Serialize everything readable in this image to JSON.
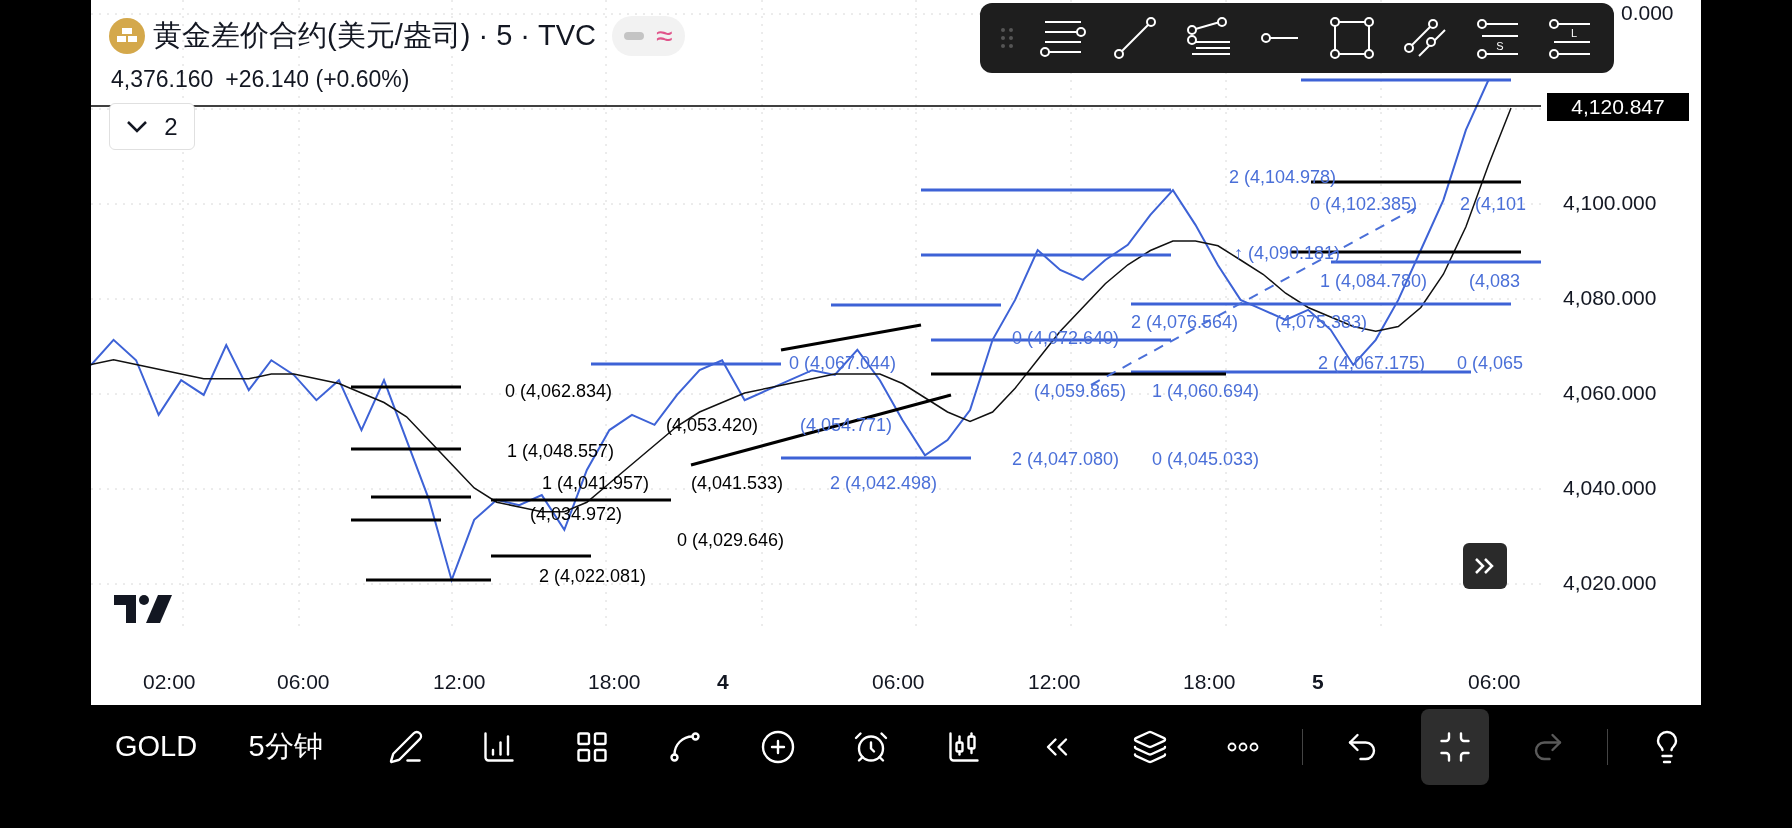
{
  "header": {
    "title": "黄金差价合约(美元/盎司) · 5 · TVC",
    "wave_glyph": "≈",
    "price": "4,376.160",
    "change": "+26.140 (+0.60%)"
  },
  "indicator_toggle": {
    "count": "2"
  },
  "drawing_toolbar": {
    "tools": [
      {
        "kind": "lines"
      },
      {
        "kind": "segment"
      },
      {
        "kind": "fib"
      },
      {
        "kind": "ray"
      },
      {
        "kind": "rect"
      },
      {
        "kind": "parallel"
      },
      {
        "kind": "short",
        "glyph": "S"
      },
      {
        "kind": "long",
        "glyph": "L"
      }
    ]
  },
  "price_axis": {
    "current_price": "4,120.847",
    "cut_label": "0.000"
  },
  "chart": {
    "chart_data": {
      "type": "line",
      "ylim": [
        4020,
        4140
      ],
      "grid": true,
      "yticks": [
        {
          "value": 4100,
          "label": "4,100.000"
        },
        {
          "value": 4080,
          "label": "4,080.000"
        },
        {
          "value": 4060,
          "label": "4,060.000"
        },
        {
          "value": 4040,
          "label": "4,040.000"
        },
        {
          "value": 4020,
          "label": "4,020.000"
        }
      ],
      "series": [
        {
          "color": "#3d62d6",
          "values": [
            4065.9,
            4071.2,
            4066.9,
            4055.4,
            4062.7,
            4059.6,
            4070.1,
            4060.6,
            4066.9,
            4063.8,
            4058.5,
            4062.7,
            4052.2,
            4062.7,
            4050.1,
            4037.5,
            4020.6,
            4033.3,
            4037.5,
            4036.4,
            4038.5,
            4031.2,
            4043.8,
            4052.2,
            4055.4,
            4053.3,
            4059.6,
            4064.8,
            4066.9,
            4058.5,
            4060.6,
            4062.7,
            4064.8,
            4063.8,
            4069.1,
            4062.7,
            4054.3,
            4046.9,
            4050.1,
            4056.4,
            4071.2,
            4079.6,
            4090.1,
            4085.9,
            4083.8,
            4088,
            4091.2,
            4097.5,
            4102.7,
            4095.4,
            4086.9,
            4079.6,
            4077.5,
            4075.4,
            4077.5,
            4073.3,
            4065.9,
            4071.2,
            4079.6,
            4090.1,
            4100.6,
            4115.4,
            4125.9,
            null
          ]
        },
        {
          "color": "#111111",
          "values": [
            4066,
            4067,
            4066,
            4065,
            4064,
            4063,
            4063,
            4063,
            4064,
            4064,
            4063,
            4062,
            4060,
            4058,
            4055,
            4050,
            4045,
            4040,
            4037,
            4036,
            4035,
            4035,
            4037,
            4041,
            4045,
            4049,
            4053,
            4056,
            4058,
            4060,
            4061,
            4062,
            4063,
            4064,
            4064,
            4064,
            4062,
            4059,
            4056,
            4054,
            4056,
            4061,
            4067,
            4073,
            4078,
            4083,
            4087,
            4090,
            4092,
            4092,
            4091,
            4088,
            4085,
            4081,
            4078,
            4076,
            4074,
            4073,
            4074,
            4078,
            4085,
            4095,
            4108,
            4120
          ]
        }
      ]
    }
  },
  "time_axis": {
    "labels": [
      {
        "text": "02:00",
        "bold": false
      },
      {
        "text": "06:00",
        "bold": false
      },
      {
        "text": "12:00",
        "bold": false
      },
      {
        "text": "18:00",
        "bold": false
      },
      {
        "text": "4",
        "bold": true
      },
      {
        "text": "06:00",
        "bold": false
      },
      {
        "text": "12:00",
        "bold": false
      },
      {
        "text": "18:00",
        "bold": false
      },
      {
        "text": "5",
        "bold": true
      },
      {
        "text": "06:00",
        "bold": false
      }
    ]
  },
  "drawing_labels": [
    {
      "text": "2 (4,104.978)",
      "color": "#4a6fd8"
    },
    {
      "text": "0 (4,102.385)",
      "color": "#4a6fd8"
    },
    {
      "text": "2 (4,101",
      "color": "#4a6fd8"
    },
    {
      "text": "↑ (4,090.181)",
      "color": "#4a6fd8"
    },
    {
      "text": "1 (4,084.780)",
      "color": "#4a6fd8"
    },
    {
      "text": "(4,083",
      "color": "#4a6fd8"
    },
    {
      "text": "2 (4,076.564)",
      "color": "#4a6fd8"
    },
    {
      "text": "(4,075.383)",
      "color": "#4a6fd8"
    },
    {
      "text": "0 (4,072.640)",
      "color": "#4a6fd8"
    },
    {
      "text": "0 (4,067.044)",
      "color": "#4a6fd8"
    },
    {
      "text": "2 (4,067.175)",
      "color": "#4a6fd8"
    },
    {
      "text": "0 (4,065",
      "color": "#4a6fd8"
    },
    {
      "text": "0 (4,062.834)",
      "color": "#000000"
    },
    {
      "text": "(4,059.865)",
      "color": "#4a6fd8"
    },
    {
      "text": "1 (4,060.694)",
      "color": "#4a6fd8"
    },
    {
      "text": "(4,053.420)",
      "color": "#000000"
    },
    {
      "text": "(4,054.771)",
      "color": "#4a6fd8"
    },
    {
      "text": "1 (4,048.557)",
      "color": "#000000"
    },
    {
      "text": "2 (4,047.080)",
      "color": "#4a6fd8"
    },
    {
      "text": "0 (4,045.033)",
      "color": "#4a6fd8"
    },
    {
      "text": "1 (4,041.957)",
      "color": "#000000"
    },
    {
      "text": "(4,041.533)",
      "color": "#000000"
    },
    {
      "text": "2 (4,042.498)",
      "color": "#4a6fd8"
    },
    {
      "text": "(4,034.972)",
      "color": "#000000"
    },
    {
      "text": "0 (4,029.646)",
      "color": "#000000"
    },
    {
      "text": "2 (4,022.081)",
      "color": "#000000"
    }
  ],
  "bottom_bar": {
    "symbol": "GOLD",
    "interval": "5分钟",
    "tools": [
      {
        "kind": "pen",
        "selected": false,
        "disabled": false
      },
      {
        "kind": "indicators",
        "selected": false,
        "disabled": false
      },
      {
        "kind": "grid",
        "selected": false,
        "disabled": false
      },
      {
        "kind": "patterns",
        "selected": false,
        "disabled": false
      },
      {
        "kind": "add",
        "selected": false,
        "disabled": false
      },
      {
        "kind": "alarm",
        "selected": false,
        "disabled": false
      },
      {
        "kind": "candles",
        "selected": false,
        "disabled": false
      },
      {
        "kind": "replay",
        "selected": false,
        "disabled": false
      },
      {
        "kind": "layers",
        "selected": false,
        "disabled": false
      },
      {
        "kind": "more",
        "selected": false,
        "disabled": false
      },
      {
        "kind": "undo",
        "selected": false,
        "disabled": false
      },
      {
        "kind": "compress",
        "selected": true,
        "disabled": false
      },
      {
        "kind": "redo",
        "selected": false,
        "disabled": true
      },
      {
        "kind": "idea",
        "selected": false,
        "disabled": false
      }
    ]
  }
}
